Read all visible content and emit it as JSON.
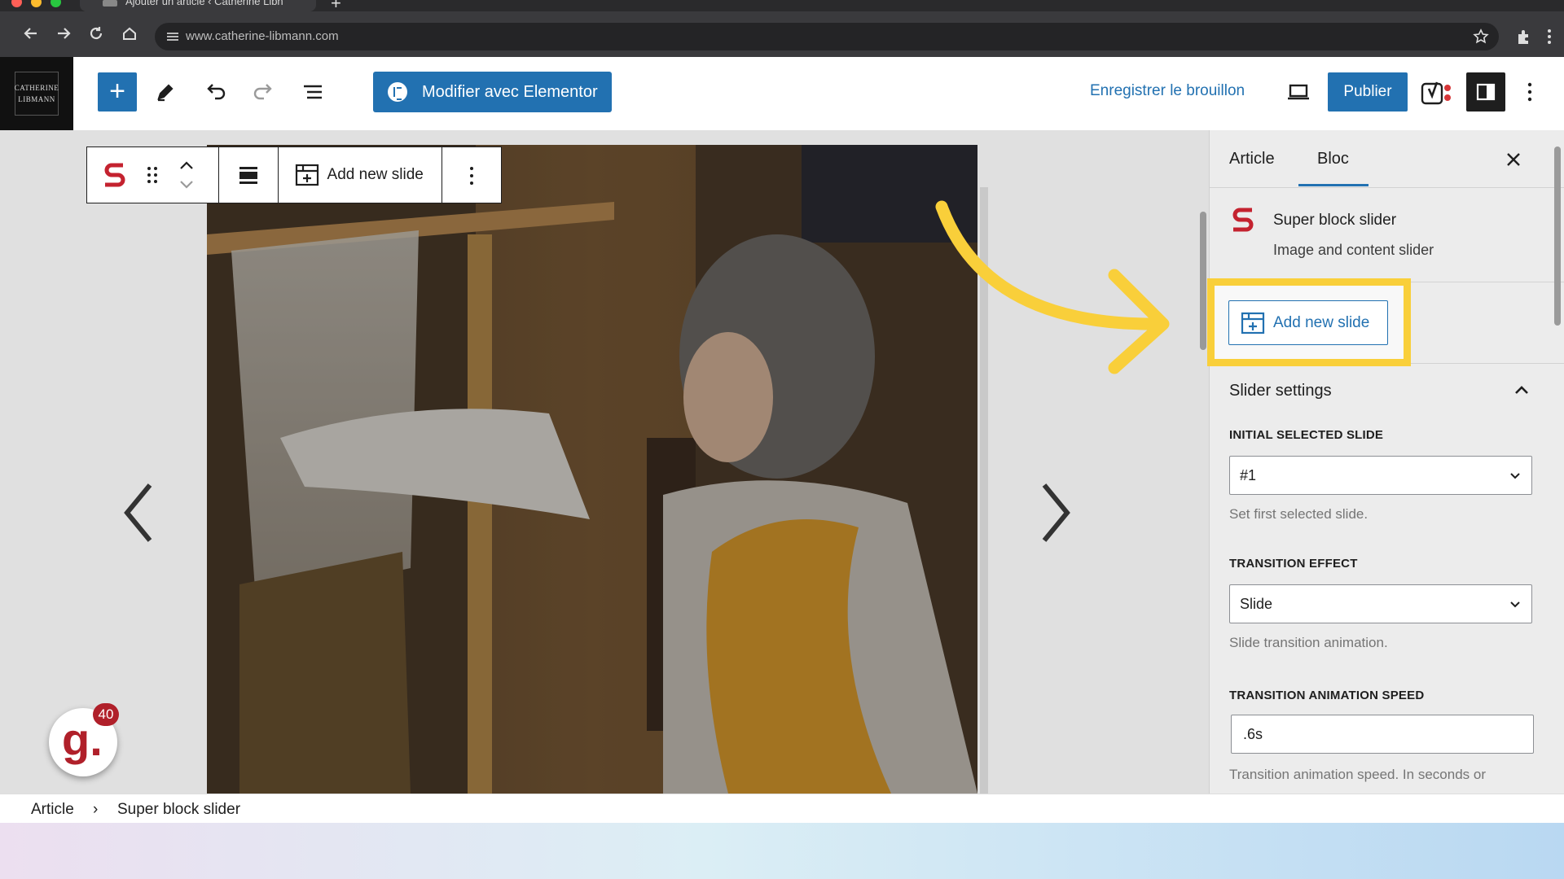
{
  "browser": {
    "tab_title": "Ajouter un article ‹ Catherine Libn",
    "url": "www.catherine-libmann.com"
  },
  "logo": {
    "line1": "CATHERINE",
    "line2": "LIBMANN"
  },
  "toolbar": {
    "elementor_label": "Modifier avec Elementor",
    "save_draft_label": "Enregistrer le brouillon",
    "publish_label": "Publier"
  },
  "block_toolbar": {
    "add_slide_label": "Add new slide"
  },
  "sidebar": {
    "tabs": [
      {
        "label": "Article"
      },
      {
        "label": "Bloc"
      }
    ],
    "block": {
      "title": "Super block slider",
      "description": "Image and content slider",
      "add_slide_label": "Add new slide"
    },
    "section_title": "Slider settings",
    "fields": {
      "initial_slide": {
        "label": "INITIAL SELECTED SLIDE",
        "value": "#1",
        "help": "Set first selected slide."
      },
      "transition_effect": {
        "label": "TRANSITION EFFECT",
        "value": "Slide",
        "help": "Slide transition animation."
      },
      "transition_speed": {
        "label": "TRANSITION ANIMATION SPEED",
        "value": ".6s",
        "help": "Transition animation speed. In seconds or"
      }
    }
  },
  "breadcrumb": {
    "items": [
      "Article",
      "Super block slider"
    ],
    "separator": "›"
  },
  "badge": {
    "letter": "g.",
    "count": "40"
  },
  "colors": {
    "accent": "#2271b1",
    "highlight": "#f9cf3a",
    "brand_red": "#b0202a"
  }
}
